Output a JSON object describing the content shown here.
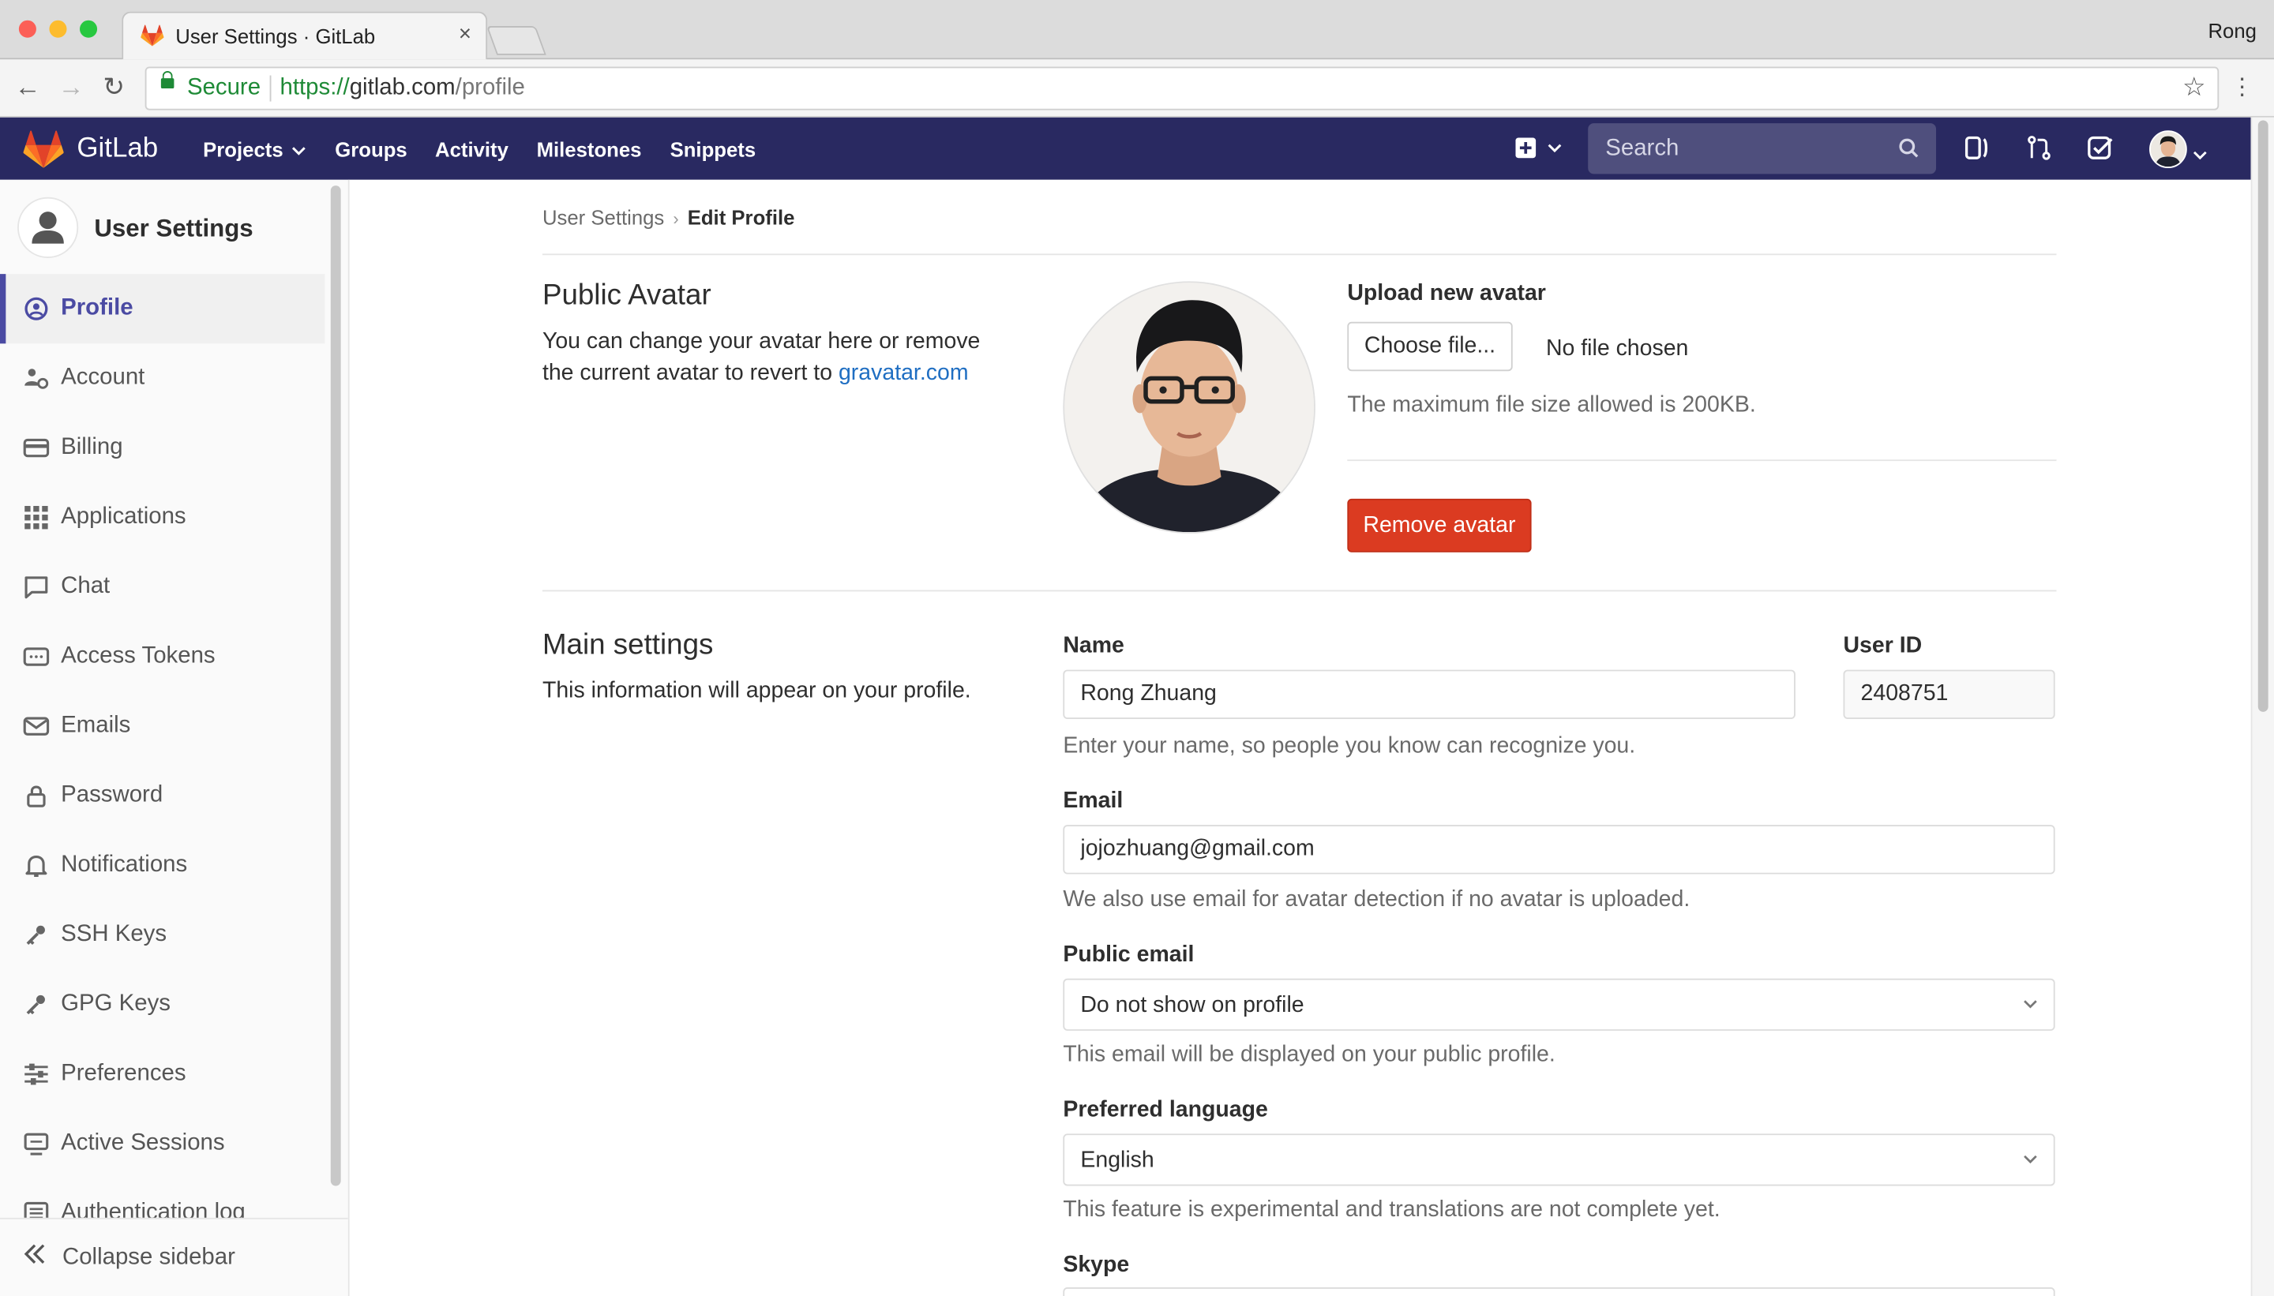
{
  "browser": {
    "tab_title": "User Settings · GitLab",
    "tab_close": "×",
    "profile_name": "Rong",
    "secure_label": "Secure",
    "url_scheme": "https://",
    "url_host": "gitlab.com",
    "url_path": "/profile"
  },
  "header": {
    "brand": "GitLab",
    "nav": [
      "Projects",
      "Groups",
      "Activity",
      "Milestones",
      "Snippets"
    ],
    "search_placeholder": "Search"
  },
  "sidebar": {
    "title": "User Settings",
    "items": [
      {
        "label": "Profile",
        "icon": "profile-icon",
        "active": true
      },
      {
        "label": "Account",
        "icon": "account-icon"
      },
      {
        "label": "Billing",
        "icon": "credit-card-icon"
      },
      {
        "label": "Applications",
        "icon": "grid-icon"
      },
      {
        "label": "Chat",
        "icon": "chat-icon"
      },
      {
        "label": "Access Tokens",
        "icon": "token-icon"
      },
      {
        "label": "Emails",
        "icon": "mail-icon"
      },
      {
        "label": "Password",
        "icon": "lock-icon"
      },
      {
        "label": "Notifications",
        "icon": "bell-icon"
      },
      {
        "label": "SSH Keys",
        "icon": "key-icon"
      },
      {
        "label": "GPG Keys",
        "icon": "key-icon"
      },
      {
        "label": "Preferences",
        "icon": "sliders-icon"
      },
      {
        "label": "Active Sessions",
        "icon": "monitor-icon"
      },
      {
        "label": "Authentication log",
        "icon": "list-icon"
      }
    ],
    "collapse_label": "Collapse sidebar"
  },
  "breadcrumb": {
    "parent": "User Settings",
    "current": "Edit Profile"
  },
  "avatar_section": {
    "title": "Public Avatar",
    "desc_prefix": "You can change your avatar here or remove the current avatar to revert to ",
    "desc_link": "gravatar.com",
    "upload_label": "Upload new avatar",
    "choose_file": "Choose file...",
    "no_file": "No file chosen",
    "max_size_help": "The maximum file size allowed is 200KB.",
    "remove_button": "Remove avatar"
  },
  "main_settings": {
    "title": "Main settings",
    "desc": "This information will appear on your profile.",
    "name_label": "Name",
    "name_value": "Rong Zhuang",
    "name_help": "Enter your name, so people you know can recognize you.",
    "userid_label": "User ID",
    "userid_value": "2408751",
    "email_label": "Email",
    "email_value": "jojozhuang@gmail.com",
    "email_help": "We also use email for avatar detection if no avatar is uploaded.",
    "public_email_label": "Public email",
    "public_email_value": "Do not show on profile",
    "public_email_help": "This email will be displayed on your public profile.",
    "language_label": "Preferred language",
    "language_value": "English",
    "language_help": "This feature is experimental and translations are not complete yet.",
    "skype_label": "Skype"
  },
  "colors": {
    "header_bg": "#292961",
    "active_accent": "#4b4ba3",
    "danger": "#db3b21",
    "link": "#1f6ec2",
    "secure_green": "#1e8a36"
  }
}
